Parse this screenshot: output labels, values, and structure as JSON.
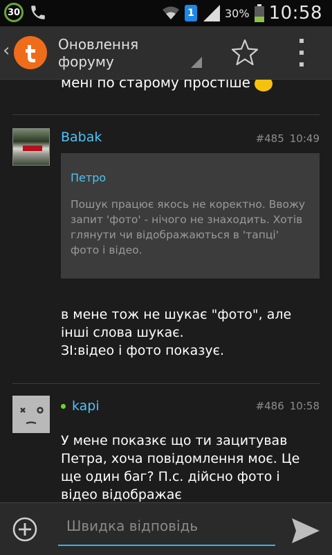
{
  "statusbar": {
    "badge": "30",
    "sim": "1",
    "battery": "30%",
    "time": "10:58"
  },
  "header": {
    "title_line1": "Оновлення",
    "title_line2": "форуму"
  },
  "previous_post": {
    "tail": "мені по старому простіше"
  },
  "posts": [
    {
      "author": "Babak",
      "number": "#485",
      "time": "10:49",
      "quote": {
        "author": "Петро",
        "text": "Пошук працює якось не коректно. Ввожу запит 'фото' - нічого не знаходить. Хотів глянути чи відображаються в 'тапці' фото і відео."
      },
      "lines": [
        "в мене тож не шукає \"фото\", але",
        "інші слова шукає.",
        "ЗІ:відео і фото показує."
      ]
    },
    {
      "author": "kapi",
      "online": true,
      "number": "#486",
      "time": "10:58",
      "lines": [
        "У мене показкє що ти зацитував",
        "Петра, хоча повідомлення моє. Це",
        "ще один баг? П.с. дійсно фото і",
        "відео відображає"
      ]
    }
  ],
  "reply": {
    "placeholder": "Швидка відповідь"
  },
  "colors": {
    "accent": "#33b5e5",
    "link": "#4fc3f7",
    "online": "#6cd32e",
    "brand": "#ef6c1a"
  }
}
